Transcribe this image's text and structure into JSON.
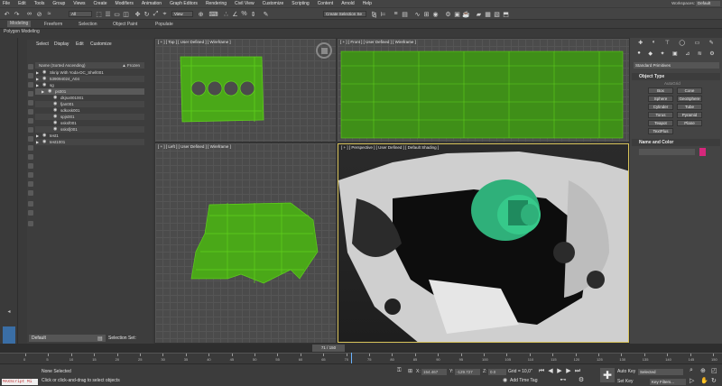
{
  "menubar": {
    "items": [
      "File",
      "Edit",
      "Tools",
      "Group",
      "Views",
      "Create",
      "Modifiers",
      "Animation",
      "Graph Editors",
      "Rendering",
      "Civil View",
      "Customize",
      "Scripting",
      "Content",
      "Arnold",
      "Help"
    ],
    "workspaces_label": "Workspaces:",
    "workspaces_value": "Default"
  },
  "toolbar": {
    "filter_value": "All",
    "view_value": "View",
    "selection_set_placeholder": "Create Selection Se"
  },
  "ribbon": {
    "tabs": [
      "Modeling",
      "Freeform",
      "Selection",
      "Object Paint",
      "Populate"
    ],
    "active": "Modeling",
    "sub_label": "Polygon Modeling"
  },
  "explorer": {
    "tabs": [
      "Select",
      "Display",
      "Edit",
      "Customize"
    ],
    "column_header": "Name (Sorted Ascending)",
    "frozen_header": "▲ Frozen",
    "rows": [
      {
        "name": "Skrip With Yoda-DC_Shell001",
        "indent": 0,
        "expand": true
      },
      {
        "name": "539094024_A04",
        "indent": 0,
        "expand": true
      },
      {
        "name": "sg",
        "indent": 0,
        "expand": true
      },
      {
        "name": "ps001",
        "indent": 1,
        "expand": true
      },
      {
        "name": "dkjso001001",
        "indent": 2,
        "expand": false
      },
      {
        "name": "fjan001",
        "indent": 2,
        "expand": false
      },
      {
        "name": "sdkosk001",
        "indent": 2,
        "expand": false
      },
      {
        "name": "spjs001",
        "indent": 2,
        "expand": false
      },
      {
        "name": "ssksf001",
        "indent": 2,
        "expand": false
      },
      {
        "name": "ssksfj001",
        "indent": 2,
        "expand": false
      },
      {
        "name": "test1",
        "indent": 0,
        "expand": true
      },
      {
        "name": "test1001",
        "indent": 0,
        "expand": true
      }
    ],
    "layer_value": "Default",
    "selection_set_label": "Selection Set:"
  },
  "viewports": {
    "top": "[ + ] [ Top ] [ User Defined ] [ Wireframe ]",
    "front": "[ + ] [ Front ] [ User Defined ] [ Wireframe ]",
    "left": "[ + ] [ Left ] [ User Defined ] [ Wireframe ]",
    "perspective": "[ + ] [ Perspective ] [ User Defined ] [ Default Shading ]"
  },
  "command_panel": {
    "category_dropdown": "Standard Primitives",
    "object_type_title": "Object Type",
    "autogrid_label": "AutoGrid",
    "object_buttons": [
      "Box",
      "Cone",
      "Sphere",
      "GeoSphere",
      "Cylinder",
      "Tube",
      "Torus",
      "Pyramid",
      "Teapot",
      "Plane",
      "TextPlus"
    ],
    "name_color_title": "Name and Color",
    "object_color": "#d6287c"
  },
  "timeline": {
    "frame_display": "71 / 150",
    "current_frame": 71,
    "total_frames": 150,
    "ruler_labels": [
      "0",
      "5",
      "10",
      "15",
      "20",
      "25",
      "30",
      "35",
      "40",
      "45",
      "50",
      "55",
      "60",
      "65",
      "70",
      "75",
      "80",
      "85",
      "90",
      "95",
      "100",
      "105",
      "110",
      "115",
      "120",
      "125",
      "130",
      "135",
      "140",
      "145",
      "150"
    ]
  },
  "status": {
    "maxscript_label": "MAXScript Mi",
    "line1": "None Selected",
    "line2": "Click or click-and-drag to select objects",
    "x_label": "X:",
    "x_value": "154.467",
    "y_label": "Y:",
    "y_value": "-129.727",
    "z_label": "Z:",
    "z_value": "0.0",
    "grid_text": "Grid = 10,0\"",
    "add_time_tag": "Add Time Tag",
    "auto_key": "Auto Key",
    "set_key": "Set Key",
    "selected_dropdown": "Selected",
    "key_filters": "Key Filters..."
  },
  "colors": {
    "wireframe": "#5fd01c",
    "persp_border": "#d8c35a",
    "part_green": "#2fb07a"
  }
}
